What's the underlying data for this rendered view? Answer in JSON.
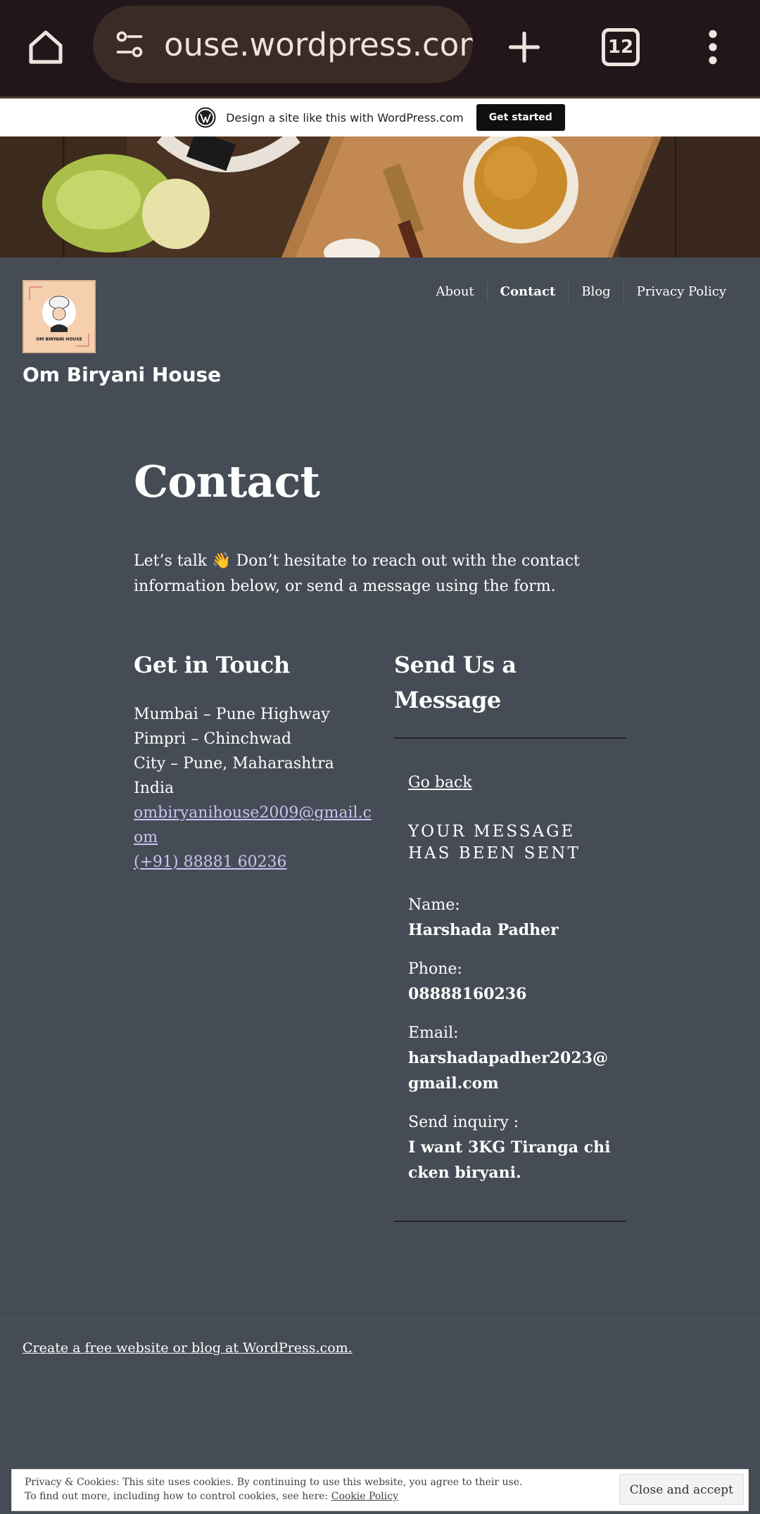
{
  "browser": {
    "url": "house.wordpress.com",
    "url_visible": " ouse.wordpress.com",
    "tab_count": "12",
    "icons": {
      "home": "home-icon",
      "site_settings": "tune-icon",
      "new_tab": "plus-icon",
      "menu": "more-vert-icon"
    }
  },
  "wp_banner": {
    "text": "Design a site like this with WordPress.com",
    "button": "Get started"
  },
  "site": {
    "title": "Om Biryani House",
    "logo_text": "OM BIRYANI HOUSE",
    "nav": [
      {
        "label": "About"
      },
      {
        "label": "Contact"
      },
      {
        "label": "Blog"
      },
      {
        "label": "Privacy Policy"
      }
    ]
  },
  "main": {
    "title": "Contact",
    "intro": "Let’s talk 👋 Don’t hesitate to reach out with the contact information below, or send a message using the form.",
    "get_in_touch": {
      "heading": "Get in Touch",
      "lines": [
        "Mumbai – Pune Highway",
        "Pimpri – Chinchwad",
        "City – Pune, Maharashtra",
        "India"
      ],
      "email": "ombiryanihouse2009@gmail.com",
      "phone": "(+91) 88881 60236"
    },
    "send_message": {
      "heading": "Send Us a Message",
      "go_back": "Go back",
      "sent_title": "YOUR MESSAGE HAS BEEN SENT",
      "fields": [
        {
          "label": "Name:",
          "value": "Harshada Padher"
        },
        {
          "label": "Phone:",
          "value": "08888160236"
        },
        {
          "label": "Email:",
          "value": "harshadapadher2023@gmail.com"
        },
        {
          "label": "Send inquiry :",
          "value": "I want 3KG Tiranga chicken biryani."
        }
      ]
    }
  },
  "footer": {
    "link": "Create a free website or blog at WordPress.com."
  },
  "cookie": {
    "line1": "Privacy & Cookies: This site uses cookies. By continuing to use this website, you agree to their use.",
    "line2_prefix": "To find out more, including how to control cookies, see here: ",
    "policy_link": "Cookie Policy",
    "close_button": "Close and accept"
  },
  "colors": {
    "page_bg": "#464c55",
    "chrome_bg": "#22161a",
    "link_color": "#c7c4f2"
  }
}
